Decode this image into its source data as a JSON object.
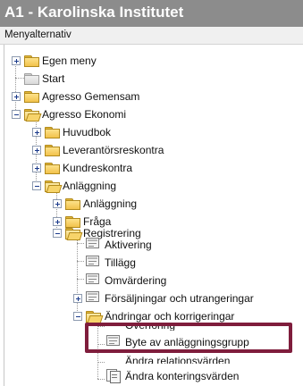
{
  "window": {
    "title": "A1 - Karolinska Institutet"
  },
  "panel": {
    "header": "Menyalternativ"
  },
  "tree": {
    "egen_meny": "Egen meny",
    "start": "Start",
    "agresso_gemensam": "Agresso Gemensam",
    "agresso_ekonomi": "Agresso Ekonomi",
    "huvudbok": "Huvudbok",
    "leverantorsreskontra": "Leverantörsreskontra",
    "kundreskontra": "Kundreskontra",
    "anlaggning_folder": "Anläggning",
    "anlaggning_sub": "Anläggning",
    "fraga": "Fråga",
    "registrering": "Registrering",
    "aktivering": "Aktivering",
    "tillagg": "Tillägg",
    "omvardering": "Omvärdering",
    "forsaljningar": "Försäljningar och utrangeringar",
    "andringar": "Ändringar och korrigeringar",
    "overforing": "Överföring",
    "byte": "Byte av anläggningsgrupp",
    "andra_relation": "Ändra relationsvärden",
    "andra_kontering": "Ändra konteringsvärden"
  },
  "annotation": {
    "color": "#7f1d3c",
    "target": "Byte av anläggningsgrupp"
  }
}
